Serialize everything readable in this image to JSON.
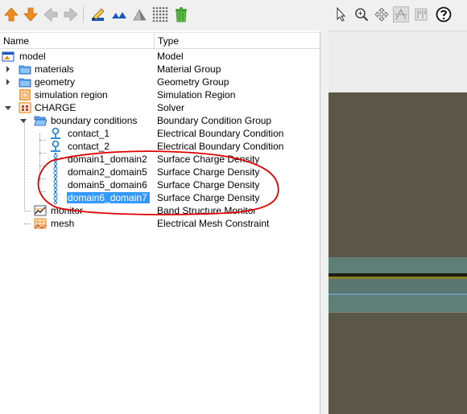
{
  "columns": {
    "name": "Name",
    "type": "Type"
  },
  "tree": [
    {
      "name": "model",
      "type": "Model",
      "icon": "model-icon"
    },
    {
      "name": "materials",
      "type": "Material Group",
      "icon": "folder-icon"
    },
    {
      "name": "geometry",
      "type": "Geometry Group",
      "icon": "folder-icon"
    },
    {
      "name": "simulation region",
      "type": "Simulation Region",
      "icon": "simulation-region-icon"
    },
    {
      "name": "CHARGE",
      "type": "Solver",
      "icon": "charge-solver-icon"
    },
    {
      "name": "boundary conditions",
      "type": "Boundary Condition Group",
      "icon": "folder-open-icon"
    },
    {
      "name": "contact_1",
      "type": "Electrical Boundary Condition",
      "icon": "contact-icon"
    },
    {
      "name": "contact_2",
      "type": "Electrical Boundary Condition",
      "icon": "contact-icon"
    },
    {
      "name": "domain1_domain2",
      "type": "Surface Charge Density",
      "icon": "surface-charge-icon"
    },
    {
      "name": "domain2_domain5",
      "type": "Surface Charge Density",
      "icon": "surface-charge-icon"
    },
    {
      "name": "domain5_domain6",
      "type": "Surface Charge Density",
      "icon": "surface-charge-icon"
    },
    {
      "name": "domain6_domain7",
      "type": "Surface Charge Density",
      "icon": "surface-charge-icon",
      "selected": true
    },
    {
      "name": "monitor",
      "type": "Band Structure Monitor",
      "icon": "monitor-icon"
    },
    {
      "name": "mesh",
      "type": "Electrical Mesh Constraint",
      "icon": "mesh-icon"
    }
  ],
  "toolbar_icons": [
    "move-up-icon",
    "move-down-icon",
    "arrow-left-icon",
    "arrow-right-icon",
    "edit-icon",
    "mountains-icon",
    "triangle-icon",
    "grid-dots-icon",
    "trash-icon"
  ],
  "view_toolbar_icons": [
    "select-cursor-icon",
    "zoom-icon",
    "pan-icon",
    "rotate-icon",
    "ruler-icon",
    "help-icon"
  ],
  "colors": {
    "selection": "#3399ff",
    "annotation": "#e00000",
    "viewport": "#5a5748",
    "accent_orange": "#f08a1c"
  }
}
